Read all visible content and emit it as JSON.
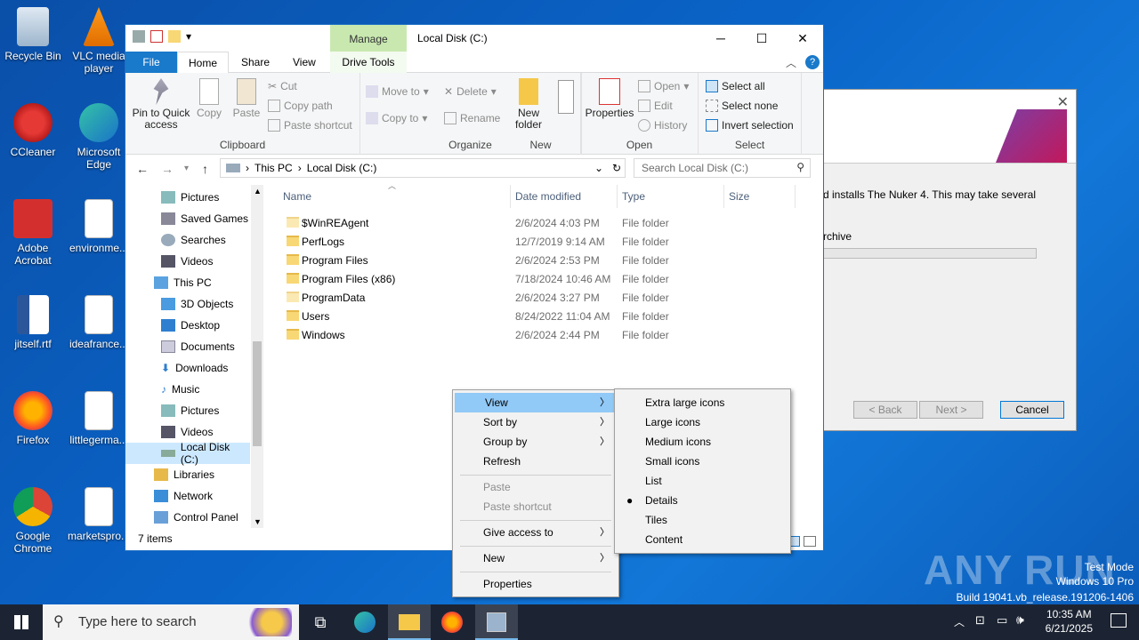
{
  "desktop": {
    "icons": [
      {
        "name": "recycle-bin",
        "label": "Recycle Bin"
      },
      {
        "name": "vlc",
        "label": "VLC media player"
      },
      {
        "name": "ccleaner",
        "label": "CCleaner"
      },
      {
        "name": "edge",
        "label": "Microsoft Edge"
      },
      {
        "name": "acrobat",
        "label": "Adobe Acrobat"
      },
      {
        "name": "environme",
        "label": "environme..."
      },
      {
        "name": "jitself",
        "label": "jitself.rtf"
      },
      {
        "name": "ideafrance",
        "label": "ideafrance..."
      },
      {
        "name": "firefox",
        "label": "Firefox"
      },
      {
        "name": "littlegerma",
        "label": "littlegerma..."
      },
      {
        "name": "chrome",
        "label": "Google Chrome"
      },
      {
        "name": "marketspro",
        "label": "marketspro..."
      }
    ]
  },
  "installer": {
    "text1": "d installs The Nuker 4.  This may take several",
    "text2": "rchive",
    "back": "< Back",
    "next": "Next >",
    "cancel": "Cancel"
  },
  "explorer": {
    "title": "Local Disk (C:)",
    "manage": "Manage",
    "tabs": {
      "file": "File",
      "home": "Home",
      "share": "Share",
      "view": "View",
      "drive": "Drive Tools"
    },
    "ribbon": {
      "pin": "Pin to Quick access",
      "copy": "Copy",
      "paste": "Paste",
      "cut": "Cut",
      "copy_path": "Copy path",
      "paste_shortcut": "Paste shortcut",
      "clipboard": "Clipboard",
      "move_to": "Move to",
      "copy_to": "Copy to",
      "delete": "Delete",
      "rename": "Rename",
      "organize": "Organize",
      "new_folder": "New folder",
      "new": "New",
      "properties": "Properties",
      "open": "Open",
      "edit": "Edit",
      "history": "History",
      "open_group": "Open",
      "select_all": "Select all",
      "select_none": "Select none",
      "invert_selection": "Invert selection",
      "select": "Select"
    },
    "address": {
      "this_pc": "This PC",
      "local_disk": "Local Disk (C:)"
    },
    "search_placeholder": "Search Local Disk (C:)",
    "nav": [
      "Pictures",
      "Saved Games",
      "Searches",
      "Videos",
      "This PC",
      "3D Objects",
      "Desktop",
      "Documents",
      "Downloads",
      "Music",
      "Pictures",
      "Videos",
      "Local Disk (C:)",
      "Libraries",
      "Network",
      "Control Panel"
    ],
    "columns": {
      "name": "Name",
      "date": "Date modified",
      "type": "Type",
      "size": "Size"
    },
    "files": [
      {
        "name": "$WinREAgent",
        "date": "2/6/2024 4:03 PM",
        "type": "File folder"
      },
      {
        "name": "PerfLogs",
        "date": "12/7/2019 9:14 AM",
        "type": "File folder"
      },
      {
        "name": "Program Files",
        "date": "2/6/2024 2:53 PM",
        "type": "File folder"
      },
      {
        "name": "Program Files (x86)",
        "date": "7/18/2024 10:46 AM",
        "type": "File folder"
      },
      {
        "name": "ProgramData",
        "date": "2/6/2024 3:27 PM",
        "type": "File folder"
      },
      {
        "name": "Users",
        "date": "8/24/2022 11:04 AM",
        "type": "File folder"
      },
      {
        "name": "Windows",
        "date": "2/6/2024 2:44 PM",
        "type": "File folder"
      }
    ],
    "status": "7 items"
  },
  "context_menu": {
    "view": "View",
    "sort_by": "Sort by",
    "group_by": "Group by",
    "refresh": "Refresh",
    "paste": "Paste",
    "paste_shortcut": "Paste shortcut",
    "give_access": "Give access to",
    "new": "New",
    "properties": "Properties"
  },
  "view_submenu": {
    "extra_large": "Extra large icons",
    "large": "Large icons",
    "medium": "Medium icons",
    "small": "Small icons",
    "list": "List",
    "details": "Details",
    "tiles": "Tiles",
    "content": "Content",
    "selected_glyph": "●"
  },
  "taskbar": {
    "search_placeholder": "Type here to search",
    "time": "10:35 AM",
    "date": "6/21/2025"
  },
  "watermark": {
    "line1": "Test Mode",
    "line2": "Windows 10 Pro",
    "line3": "Build 19041.vb_release.191206-1406",
    "brand": "ANY RUN"
  }
}
